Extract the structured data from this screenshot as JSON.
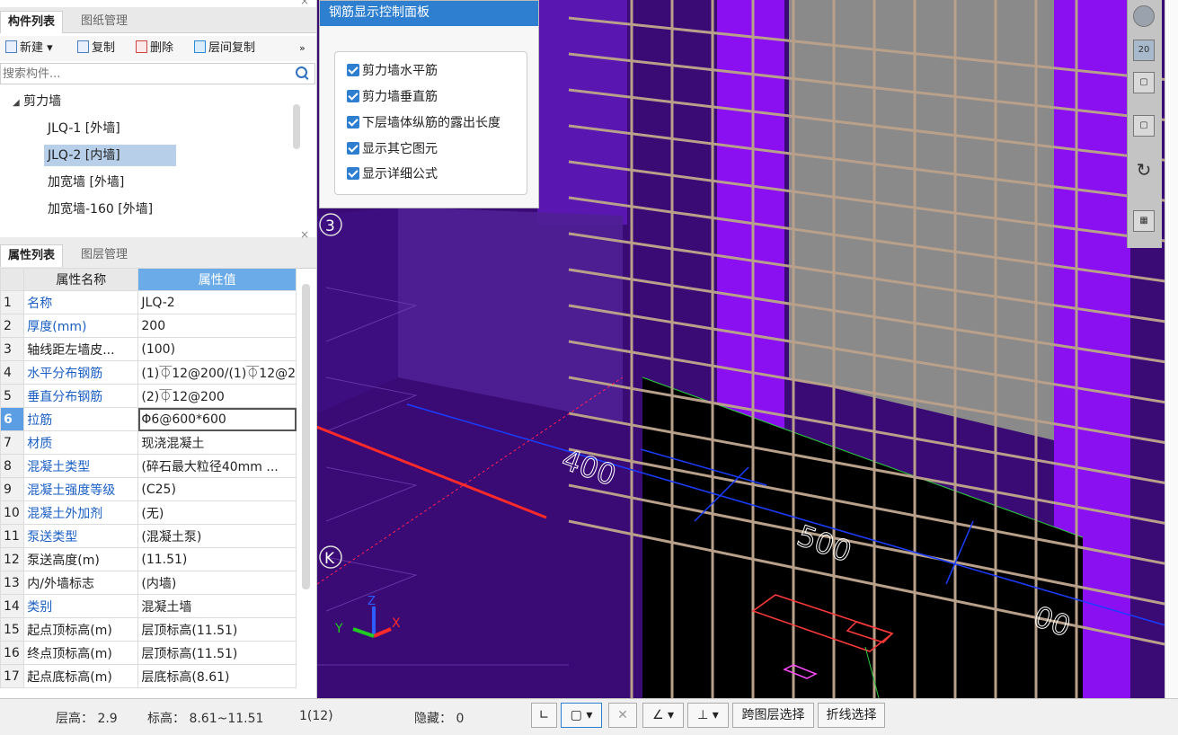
{
  "component_panel": {
    "tabs": [
      "构件列表",
      "图纸管理"
    ],
    "toolbar": {
      "new": "新建",
      "copy": "复制",
      "delete": "删除",
      "floor_copy": "层间复制",
      "more": "»"
    },
    "search_placeholder": "搜索构件...",
    "tree": {
      "root": "剪力墙",
      "items": [
        "JLQ-1 [外墙]",
        "JLQ-2 [内墙]",
        "加宽墙 [外墙]",
        "加宽墙-160 [外墙]"
      ],
      "selected_index": 1
    },
    "close": "×"
  },
  "property_panel": {
    "tabs": [
      "属性列表",
      "图层管理"
    ],
    "close": "×",
    "header": {
      "name": "属性名称",
      "value": "属性值"
    },
    "rows": [
      {
        "n": "1",
        "name": "名称",
        "value": "JLQ-2",
        "blue": true
      },
      {
        "n": "2",
        "name": "厚度(mm)",
        "value": "200",
        "blue": true
      },
      {
        "n": "3",
        "name": "轴线距左墙皮...",
        "value": "(100)",
        "blue": false
      },
      {
        "n": "4",
        "name": "水平分布钢筋",
        "value": "(1)⏁12@200/(1)⏁12@2",
        "blue": true
      },
      {
        "n": "5",
        "name": "垂直分布钢筋",
        "value": "(2)⏁12@200",
        "blue": true
      },
      {
        "n": "6",
        "name": "拉筋",
        "value": "Φ6@600*600",
        "blue": true
      },
      {
        "n": "7",
        "name": "材质",
        "value": "现浇混凝土",
        "blue": true
      },
      {
        "n": "8",
        "name": "混凝土类型",
        "value": "(碎石最大粒径40mm ...",
        "blue": true
      },
      {
        "n": "9",
        "name": "混凝土强度等级",
        "value": "(C25)",
        "blue": true
      },
      {
        "n": "10",
        "name": "混凝土外加剂",
        "value": "(无)",
        "blue": true
      },
      {
        "n": "11",
        "name": "泵送类型",
        "value": "(混凝土泵)",
        "blue": true
      },
      {
        "n": "12",
        "name": "泵送高度(m)",
        "value": "(11.51)",
        "blue": false
      },
      {
        "n": "13",
        "name": "内/外墙标志",
        "value": "(内墙)",
        "blue": false
      },
      {
        "n": "14",
        "name": "类别",
        "value": "混凝土墙",
        "blue": true
      },
      {
        "n": "15",
        "name": "起点顶标高(m)",
        "value": "层顶标高(11.51)",
        "blue": false
      },
      {
        "n": "16",
        "name": "终点顶标高(m)",
        "value": "层顶标高(11.51)",
        "blue": false
      },
      {
        "n": "17",
        "name": "起点底标高(m)",
        "value": "层底标高(8.61)",
        "blue": false
      }
    ],
    "selected_row": "6"
  },
  "control_panel": {
    "title": "钢筋显示控制面板",
    "options": [
      {
        "label": "剪力墙水平筋",
        "checked": true
      },
      {
        "label": "剪力墙垂直筋",
        "checked": true
      },
      {
        "label": "下层墙体纵筋的露出长度",
        "checked": true
      },
      {
        "label": "显示其它图元",
        "checked": true
      },
      {
        "label": "显示详细公式",
        "checked": true
      }
    ]
  },
  "viewport": {
    "axis_labels": {
      "three": "3",
      "k": "K",
      "x": "X",
      "y": "Y",
      "z": "Z"
    },
    "dims": [
      "400",
      "500",
      "00"
    ],
    "accent_purple": "#8a10f2",
    "bg_purple": "#3a0a75"
  },
  "right_toolbar": {
    "zoom_label": "20"
  },
  "status": {
    "floor_height": "层高：  2.9",
    "elevation": "标高：  8.61~11.51",
    "count": "1(12)",
    "hidden": "隐藏：  0",
    "btn_cross": "跨图层选择",
    "btn_polyline": "折线选择"
  }
}
